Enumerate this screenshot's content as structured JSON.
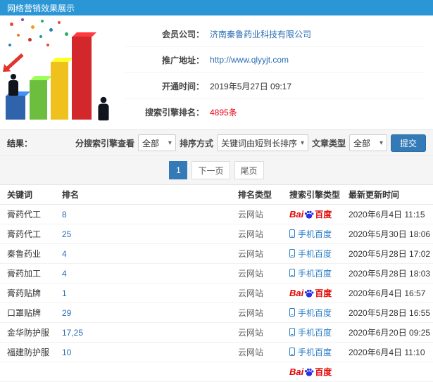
{
  "header": {
    "title": "网络营销效果展示",
    "bg_color": "#2a96d5"
  },
  "info": {
    "company_label": "会员公司：",
    "company_value": "济南秦鲁药业科技有限公司",
    "url_label": "推广地址：",
    "url_value": "http://www.qlyyjt.com",
    "open_label": "开通时间：",
    "open_value": "2019年5月27日 09:17",
    "rank_label": "搜索引擎排名：",
    "rank_value": "4895条"
  },
  "filters": {
    "result_label": "结果：",
    "engine_label": "分搜索引擎查看",
    "engine_value": "全部",
    "sort_label": "排序方式",
    "sort_value": "关键词由短到长排序",
    "article_label": "文章类型",
    "article_value": "全部",
    "submit_label": "提交"
  },
  "pagination": {
    "page1": "1",
    "next": "下一页",
    "last": "尾页"
  },
  "table": {
    "headers": [
      "关键词",
      "排名",
      "排名类型",
      "搜索引擎类型",
      "最新更新时间"
    ],
    "rows": [
      {
        "keyword": "膏药代工",
        "rank": "8",
        "rank_type": "云网站",
        "engine": "baidu",
        "time": "2020年6月4日 11:15"
      },
      {
        "keyword": "膏药代工",
        "rank": "25",
        "rank_type": "云网站",
        "engine": "mobile",
        "time": "2020年5月30日 18:06"
      },
      {
        "keyword": "秦鲁药业",
        "rank": "4",
        "rank_type": "云网站",
        "engine": "mobile",
        "time": "2020年5月28日 17:02"
      },
      {
        "keyword": "膏药加工",
        "rank": "4",
        "rank_type": "云网站",
        "engine": "mobile",
        "time": "2020年5月28日 18:03"
      },
      {
        "keyword": "膏药贴牌",
        "rank": "1",
        "rank_type": "云网站",
        "engine": "baidu",
        "time": "2020年6月4日 16:57"
      },
      {
        "keyword": "口罩贴牌",
        "rank": "29",
        "rank_type": "云网站",
        "engine": "mobile",
        "time": "2020年5月28日 16:55"
      },
      {
        "keyword": "金华防护服",
        "rank": "17,25",
        "rank_type": "云网站",
        "engine": "mobile",
        "time": "2020年6月20日 09:25"
      },
      {
        "keyword": "福建防护服",
        "rank": "10",
        "rank_type": "云网站",
        "engine": "mobile",
        "time": "2020年6月4日 11:10"
      },
      {
        "keyword": "",
        "rank": "",
        "rank_type": "",
        "engine": "baidu",
        "time": ""
      }
    ]
  },
  "engines": {
    "baidu": {
      "bai": "Bai",
      "du": "百度"
    },
    "mobile": {
      "label": "手机百度"
    }
  },
  "colors": {
    "accent_blue": "#337ab7",
    "link_blue": "#2a6db5",
    "red": "#e60012",
    "baidu_blue": "#2932e1",
    "baidu_red": "#e10601"
  }
}
